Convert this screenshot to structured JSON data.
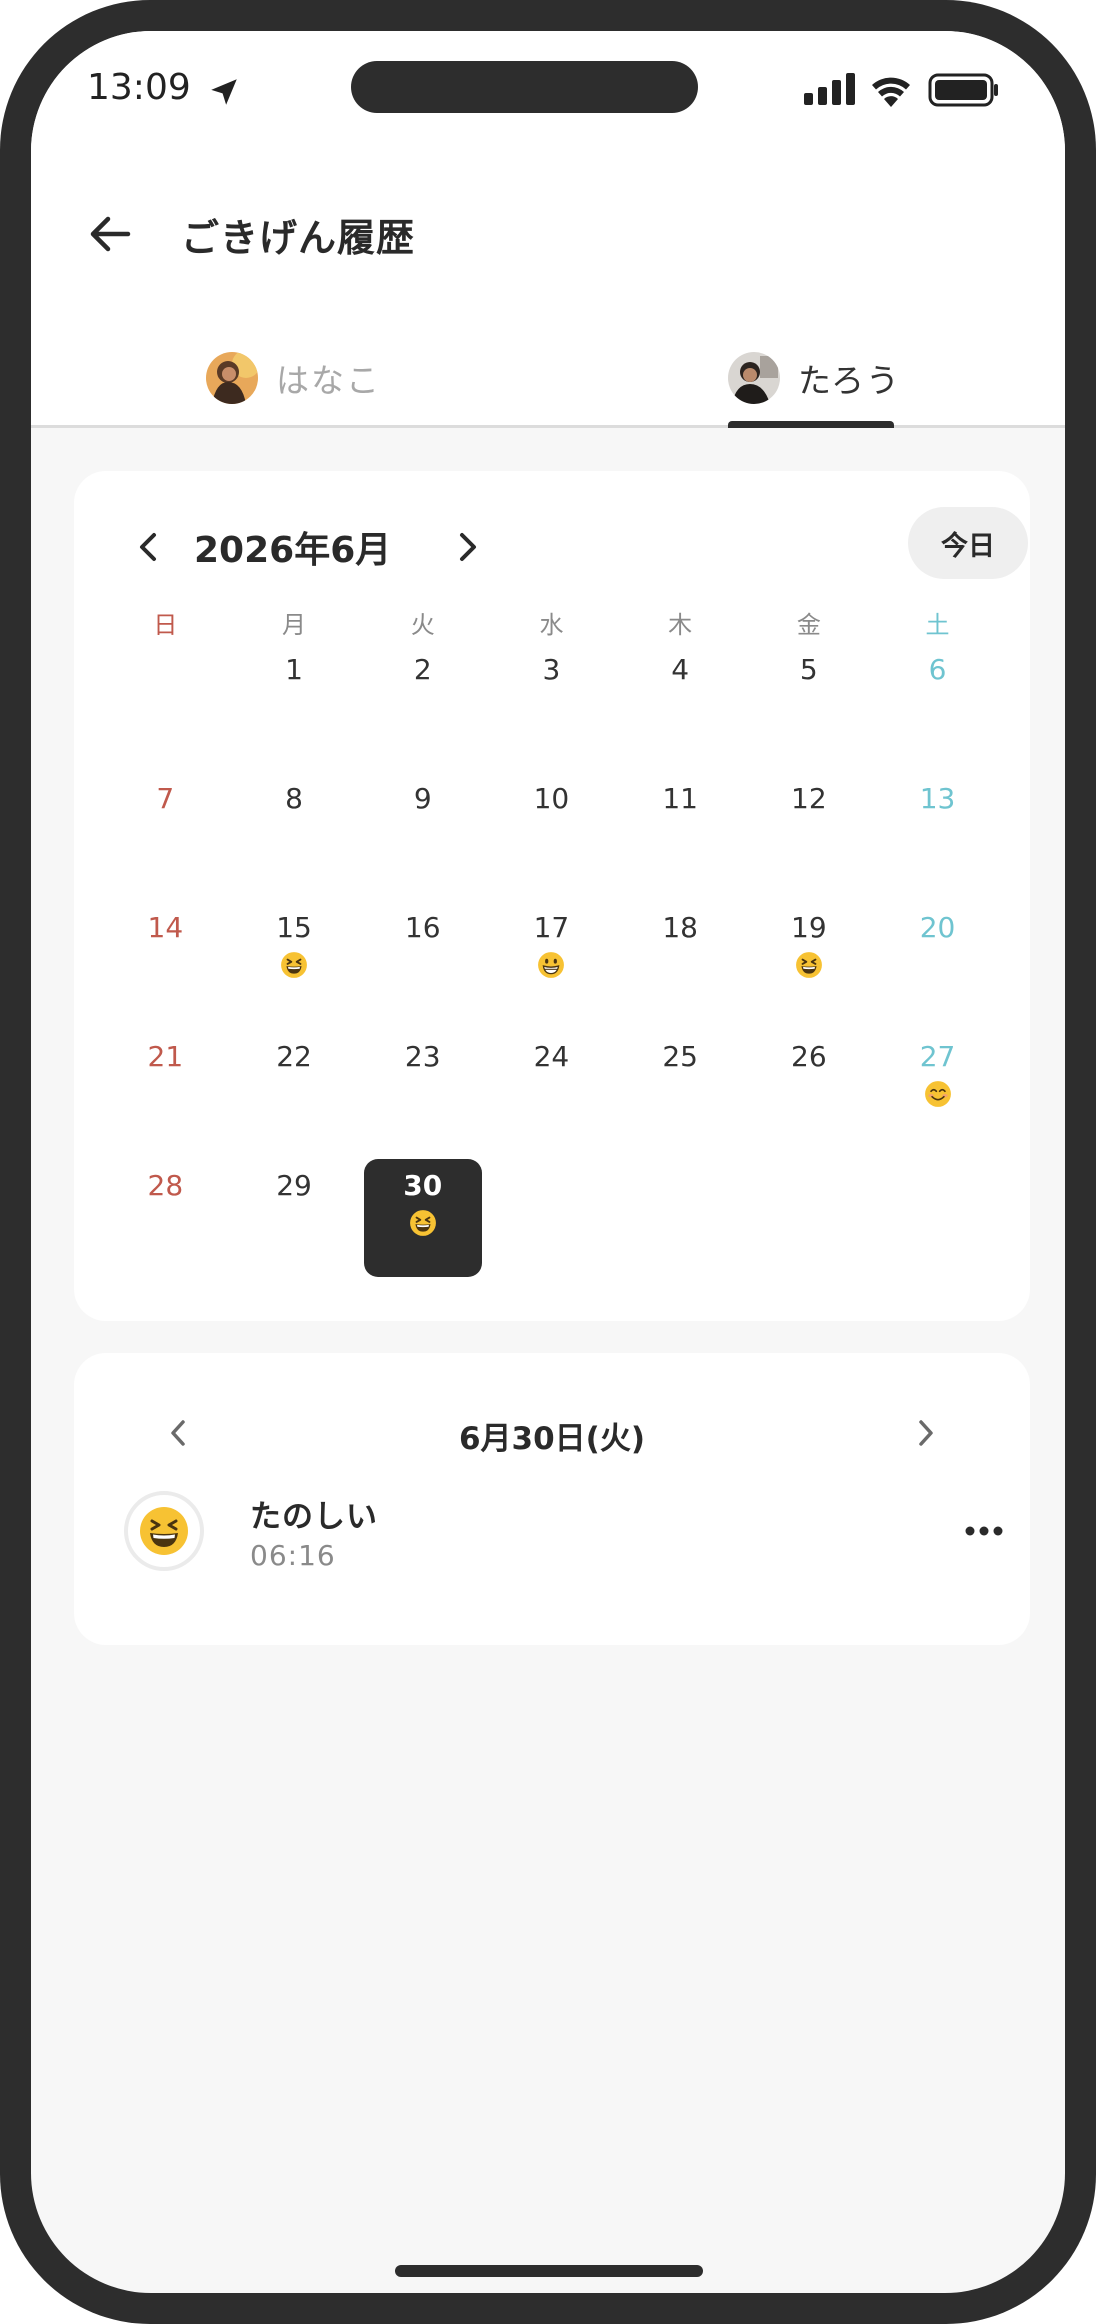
{
  "status_bar": {
    "time": "13:09",
    "icons": [
      "location-arrow-icon",
      "signal-icon",
      "wifi-icon",
      "battery-icon"
    ]
  },
  "header": {
    "title": "ごきげん履歴",
    "back_icon": "arrow-left-icon"
  },
  "tabs": [
    {
      "label": "はなこ",
      "selected": false
    },
    {
      "label": "たろう",
      "selected": true
    }
  ],
  "calendar": {
    "month_label": "2026年6月",
    "today_label": "今日",
    "weekdays": [
      "日",
      "月",
      "火",
      "水",
      "木",
      "金",
      "土"
    ],
    "colors": {
      "sunday": "#c0594c",
      "saturday": "#6fc4d0",
      "selected_bg": "#2d2d2d"
    },
    "days": [
      {
        "day": "1",
        "col": 1,
        "row": 0,
        "emoji": ""
      },
      {
        "day": "2",
        "col": 2,
        "row": 0,
        "emoji": ""
      },
      {
        "day": "3",
        "col": 3,
        "row": 0,
        "emoji": ""
      },
      {
        "day": "4",
        "col": 4,
        "row": 0,
        "emoji": ""
      },
      {
        "day": "5",
        "col": 5,
        "row": 0,
        "emoji": ""
      },
      {
        "day": "6",
        "col": 6,
        "row": 0,
        "emoji": ""
      },
      {
        "day": "7",
        "col": 0,
        "row": 1,
        "emoji": ""
      },
      {
        "day": "8",
        "col": 1,
        "row": 1,
        "emoji": ""
      },
      {
        "day": "9",
        "col": 2,
        "row": 1,
        "emoji": ""
      },
      {
        "day": "10",
        "col": 3,
        "row": 1,
        "emoji": ""
      },
      {
        "day": "11",
        "col": 4,
        "row": 1,
        "emoji": ""
      },
      {
        "day": "12",
        "col": 5,
        "row": 1,
        "emoji": ""
      },
      {
        "day": "13",
        "col": 6,
        "row": 1,
        "emoji": ""
      },
      {
        "day": "14",
        "col": 0,
        "row": 2,
        "emoji": ""
      },
      {
        "day": "15",
        "col": 1,
        "row": 2,
        "emoji": "laughing"
      },
      {
        "day": "16",
        "col": 2,
        "row": 2,
        "emoji": ""
      },
      {
        "day": "17",
        "col": 3,
        "row": 2,
        "emoji": "grin"
      },
      {
        "day": "18",
        "col": 4,
        "row": 2,
        "emoji": ""
      },
      {
        "day": "19",
        "col": 5,
        "row": 2,
        "emoji": "laughing"
      },
      {
        "day": "20",
        "col": 6,
        "row": 2,
        "emoji": ""
      },
      {
        "day": "21",
        "col": 0,
        "row": 3,
        "emoji": ""
      },
      {
        "day": "22",
        "col": 1,
        "row": 3,
        "emoji": ""
      },
      {
        "day": "23",
        "col": 2,
        "row": 3,
        "emoji": ""
      },
      {
        "day": "24",
        "col": 3,
        "row": 3,
        "emoji": ""
      },
      {
        "day": "25",
        "col": 4,
        "row": 3,
        "emoji": ""
      },
      {
        "day": "26",
        "col": 5,
        "row": 3,
        "emoji": ""
      },
      {
        "day": "27",
        "col": 6,
        "row": 3,
        "emoji": "smile"
      },
      {
        "day": "28",
        "col": 0,
        "row": 4,
        "emoji": ""
      },
      {
        "day": "29",
        "col": 1,
        "row": 4,
        "emoji": ""
      },
      {
        "day": "30",
        "col": 2,
        "row": 4,
        "emoji": "laughing",
        "selected": true
      }
    ]
  },
  "detail": {
    "date_label": "6月30日(火)",
    "entries": [
      {
        "label": "たのしい",
        "time": "06:16",
        "emoji": "laughing"
      }
    ],
    "more_icon": "more-horizontal-icon"
  }
}
